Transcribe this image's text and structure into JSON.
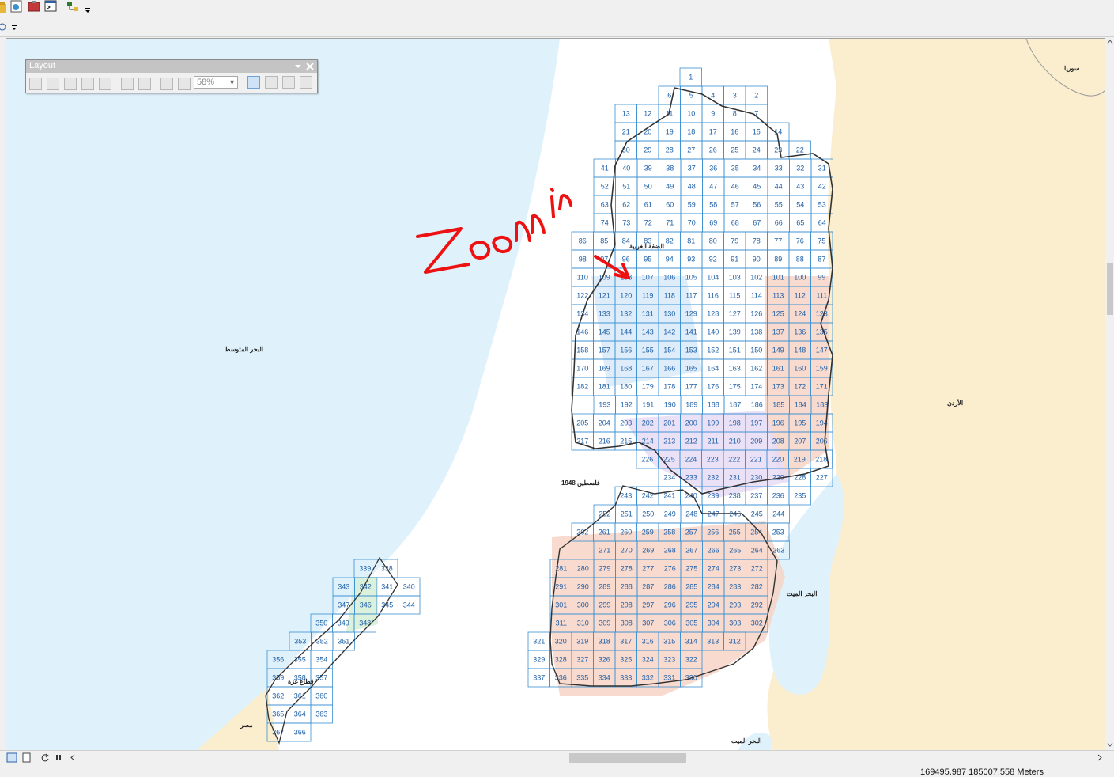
{
  "layout_toolbar": {
    "title": "Layout",
    "zoom_value": "58%"
  },
  "annotation": {
    "text": "Zoom in",
    "color": "#ee1111"
  },
  "map": {
    "labels": {
      "sea": "البحر المتوسط",
      "palestine48": "فلسطين 1948",
      "westbank": "الضفة الغربية",
      "gaza": "قطاع غزة",
      "egypt": "مصر",
      "deadsea": "البحر الميت",
      "deadsea2": "البحر الميت",
      "jordan": "الأردن",
      "syria": "سوريا"
    },
    "colors": {
      "sea": "#dff1fb",
      "land_neighbor": "#fbeecf",
      "grid_line": "#3a8fd1",
      "grid_text": "#1d5fa8",
      "region_pink": "#f7d3c6",
      "region_purple": "#e8dcf6",
      "region_green": "#d6efd6",
      "region_blue": "#d8eaf8"
    },
    "grid_rows": [
      [
        1
      ],
      [
        6,
        5,
        4,
        3,
        2
      ],
      [
        13,
        12,
        11,
        10,
        9,
        8,
        7
      ],
      [
        21,
        20,
        19,
        18,
        17,
        16,
        15,
        14
      ],
      [
        30,
        29,
        28,
        27,
        26,
        25,
        24,
        23,
        22
      ],
      [
        41,
        40,
        39,
        38,
        37,
        36,
        35,
        34,
        33,
        32,
        31
      ],
      [
        52,
        51,
        50,
        49,
        48,
        47,
        46,
        45,
        44,
        43,
        42
      ],
      [
        63,
        62,
        61,
        60,
        59,
        58,
        57,
        56,
        55,
        54,
        53
      ],
      [
        74,
        73,
        72,
        71,
        70,
        69,
        68,
        67,
        66,
        65,
        64
      ],
      [
        86,
        85,
        84,
        83,
        82,
        81,
        80,
        79,
        78,
        77,
        76,
        75
      ],
      [
        98,
        97,
        96,
        95,
        94,
        93,
        92,
        91,
        90,
        89,
        88,
        87
      ],
      [
        110,
        109,
        108,
        107,
        106,
        105,
        104,
        103,
        102,
        101,
        100,
        99
      ],
      [
        122,
        121,
        120,
        119,
        118,
        117,
        116,
        115,
        114,
        113,
        112,
        111
      ],
      [
        134,
        133,
        132,
        131,
        130,
        129,
        128,
        127,
        126,
        125,
        124,
        123
      ],
      [
        146,
        145,
        144,
        143,
        142,
        141,
        140,
        139,
        138,
        137,
        136,
        135
      ],
      [
        158,
        157,
        156,
        155,
        154,
        153,
        152,
        151,
        150,
        149,
        148,
        147
      ],
      [
        170,
        169,
        168,
        167,
        166,
        165,
        164,
        163,
        162,
        161,
        160,
        159
      ],
      [
        182,
        181,
        180,
        179,
        178,
        177,
        176,
        175,
        174,
        173,
        172,
        171
      ],
      [
        193,
        192,
        191,
        190,
        189,
        188,
        187,
        186,
        185,
        184,
        183
      ],
      [
        205,
        204,
        203,
        202,
        201,
        200,
        199,
        198,
        197,
        196,
        195,
        194
      ],
      [
        217,
        216,
        215,
        214,
        213,
        212,
        211,
        210,
        209,
        208,
        207,
        206
      ],
      [
        226,
        225,
        224,
        223,
        222,
        221,
        220,
        219,
        218
      ],
      [
        234,
        233,
        232,
        231,
        230,
        229,
        228,
        227
      ],
      [
        243,
        242,
        241,
        240,
        239,
        238,
        237,
        236,
        235
      ],
      [
        252,
        251,
        250,
        249,
        248,
        247,
        246,
        245,
        244
      ],
      [
        262,
        261,
        260,
        259,
        258,
        257,
        256,
        255,
        254,
        253
      ],
      [
        271,
        270,
        269,
        268,
        267,
        266,
        265,
        264,
        263
      ],
      [
        281,
        280,
        279,
        278,
        277,
        276,
        275,
        274,
        273,
        272
      ],
      [
        291,
        290,
        289,
        288,
        287,
        286,
        285,
        284,
        283,
        282
      ],
      [
        301,
        300,
        299,
        298,
        297,
        296,
        295,
        294,
        293,
        292
      ],
      [
        311,
        310,
        309,
        308,
        307,
        306,
        305,
        304,
        303,
        302
      ],
      [
        321,
        320,
        319,
        318,
        317,
        316,
        315,
        314,
        313,
        312
      ],
      [
        329,
        328,
        327,
        326,
        325,
        324,
        323,
        322
      ],
      [
        337,
        336,
        335,
        334,
        333,
        332,
        331,
        330
      ],
      [
        339,
        338
      ],
      [
        343,
        342,
        341,
        340
      ],
      [
        347,
        346,
        345,
        344
      ],
      [
        350,
        349,
        348
      ],
      [
        353,
        352,
        351
      ],
      [
        356,
        355,
        354
      ],
      [
        359,
        358,
        357
      ],
      [
        362,
        361,
        360
      ],
      [
        365,
        364,
        363
      ],
      [
        367,
        366
      ]
    ]
  },
  "status": {
    "coordinates": "169495.987  185007.558 Meters"
  }
}
